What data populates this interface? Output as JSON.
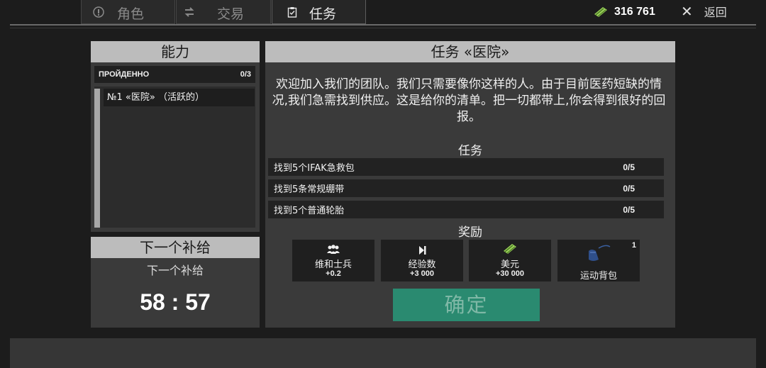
{
  "tabs": [
    {
      "label": "角色",
      "icon": "character-icon"
    },
    {
      "label": "交易",
      "icon": "trade-arrows-icon"
    },
    {
      "label": "任务",
      "icon": "clipboard-icon"
    }
  ],
  "header": {
    "money": "316 761",
    "back_label": "返回"
  },
  "abilities": {
    "title": "能力",
    "completed_label": "ПРОЙДЕННО",
    "completed_count": "0/3",
    "quest_item": "№1 «医院» （活跃的）"
  },
  "supply": {
    "title": "下一个补给",
    "label": "下一个补给",
    "timer": "58 : 57"
  },
  "quest": {
    "title": "任务 «医院»",
    "description": "欢迎加入我们的团队。我们只需要像你这样的人。由于目前医药短缺的情况,我们急需找到供应。这是给你的清单。把一切都带上,你会得到很好的回报。",
    "tasks_title": "任务",
    "tasks": [
      {
        "text": "找到5个IFAK急救包",
        "count": "0/5"
      },
      {
        "text": "找到5条常规绷带",
        "count": "0/5"
      },
      {
        "text": "找到5个普通轮胎",
        "count": "0/5"
      }
    ],
    "rewards_title": "奖励",
    "rewards": [
      {
        "name": "维和士兵",
        "amount": "+0.2",
        "icon": "soldiers-icon"
      },
      {
        "name": "经验数",
        "amount": "+3 000",
        "icon": "experience-icon"
      },
      {
        "name": "美元",
        "amount": "+30 000",
        "icon": "money-stack-icon"
      },
      {
        "name": "运动背包",
        "quantity": "1",
        "icon": "backpack-icon"
      }
    ],
    "confirm_label": "确定"
  },
  "colors": {
    "accent_green": "#2a8a70",
    "panel_header": "#bcbcbc",
    "money_green": "#9bd25a"
  }
}
